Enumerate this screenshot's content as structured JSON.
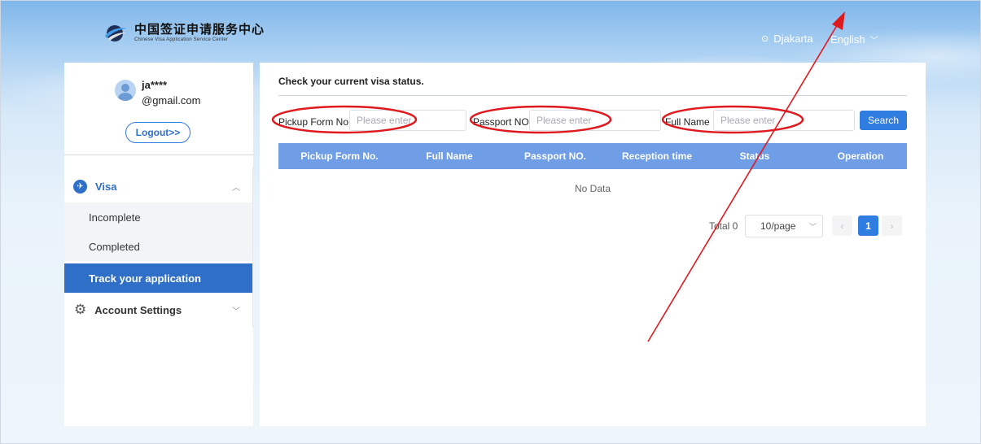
{
  "header": {
    "logo_cn": "中国签证申请服务中心",
    "logo_en": "Chinese Visa Application Service Center",
    "city": "Djakarta",
    "language": "English"
  },
  "sidebar": {
    "user_name": "ja****",
    "user_email": "@gmail.com",
    "logout_label": "Logout>>",
    "visa_label": "Visa",
    "items": [
      {
        "label": "Incomplete"
      },
      {
        "label": "Completed"
      },
      {
        "label": "Track your application"
      }
    ],
    "account_label": "Account Settings"
  },
  "main": {
    "heading": "Check your current visa status.",
    "filters": {
      "pickup_label": "Pickup Form No.",
      "pickup_placeholder": "Please enter",
      "passport_label": "Passport NO.",
      "passport_placeholder": "Please enter",
      "fullname_label": "Full Name",
      "fullname_placeholder": "Please enter"
    },
    "search_label": "Search",
    "columns": [
      "Pickup Form No.",
      "Full Name",
      "Passport NO.",
      "Reception time",
      "Status",
      "Operation"
    ],
    "empty_text": "No Data",
    "pagination": {
      "total": "Total 0",
      "page_size": "10/page",
      "current_page": "1"
    }
  },
  "colors": {
    "accent": "#2f7de1",
    "table_header": "#6f9ee6",
    "annotation": "#e0191e"
  }
}
